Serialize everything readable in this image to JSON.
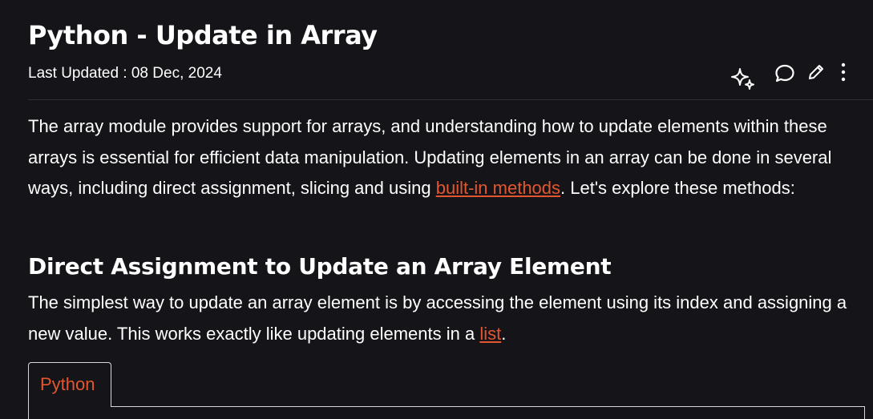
{
  "article": {
    "title": "Python - Update in Array",
    "last_updated": "Last Updated : 08 Dec, 2024"
  },
  "toolbar": {
    "icons": [
      "sparkle-icon",
      "comment-icon",
      "edit-icon",
      "more-options-icon"
    ]
  },
  "intro": {
    "text_before_link": "The array module provides support for arrays, and understanding how to update elements within these arrays is essential for efficient data manipulation. Updating elements in an array can be done in several ways, including direct assignment, slicing and using ",
    "link": "built-in methods",
    "text_after_link": ". Let's explore these methods:"
  },
  "section": {
    "heading": "Direct Assignment to Update an Array Element",
    "text_before_link": "The simplest way to update an array element is by accessing the element using its index and assigning a new value. This works exactly like updating elements in a ",
    "link": "list",
    "text_after_link": "."
  },
  "code_block": {
    "tab_label": "Python"
  },
  "colors": {
    "background": "#141419",
    "text": "#ffffff",
    "link": "#e4572e",
    "border": "#d7d7d7"
  }
}
